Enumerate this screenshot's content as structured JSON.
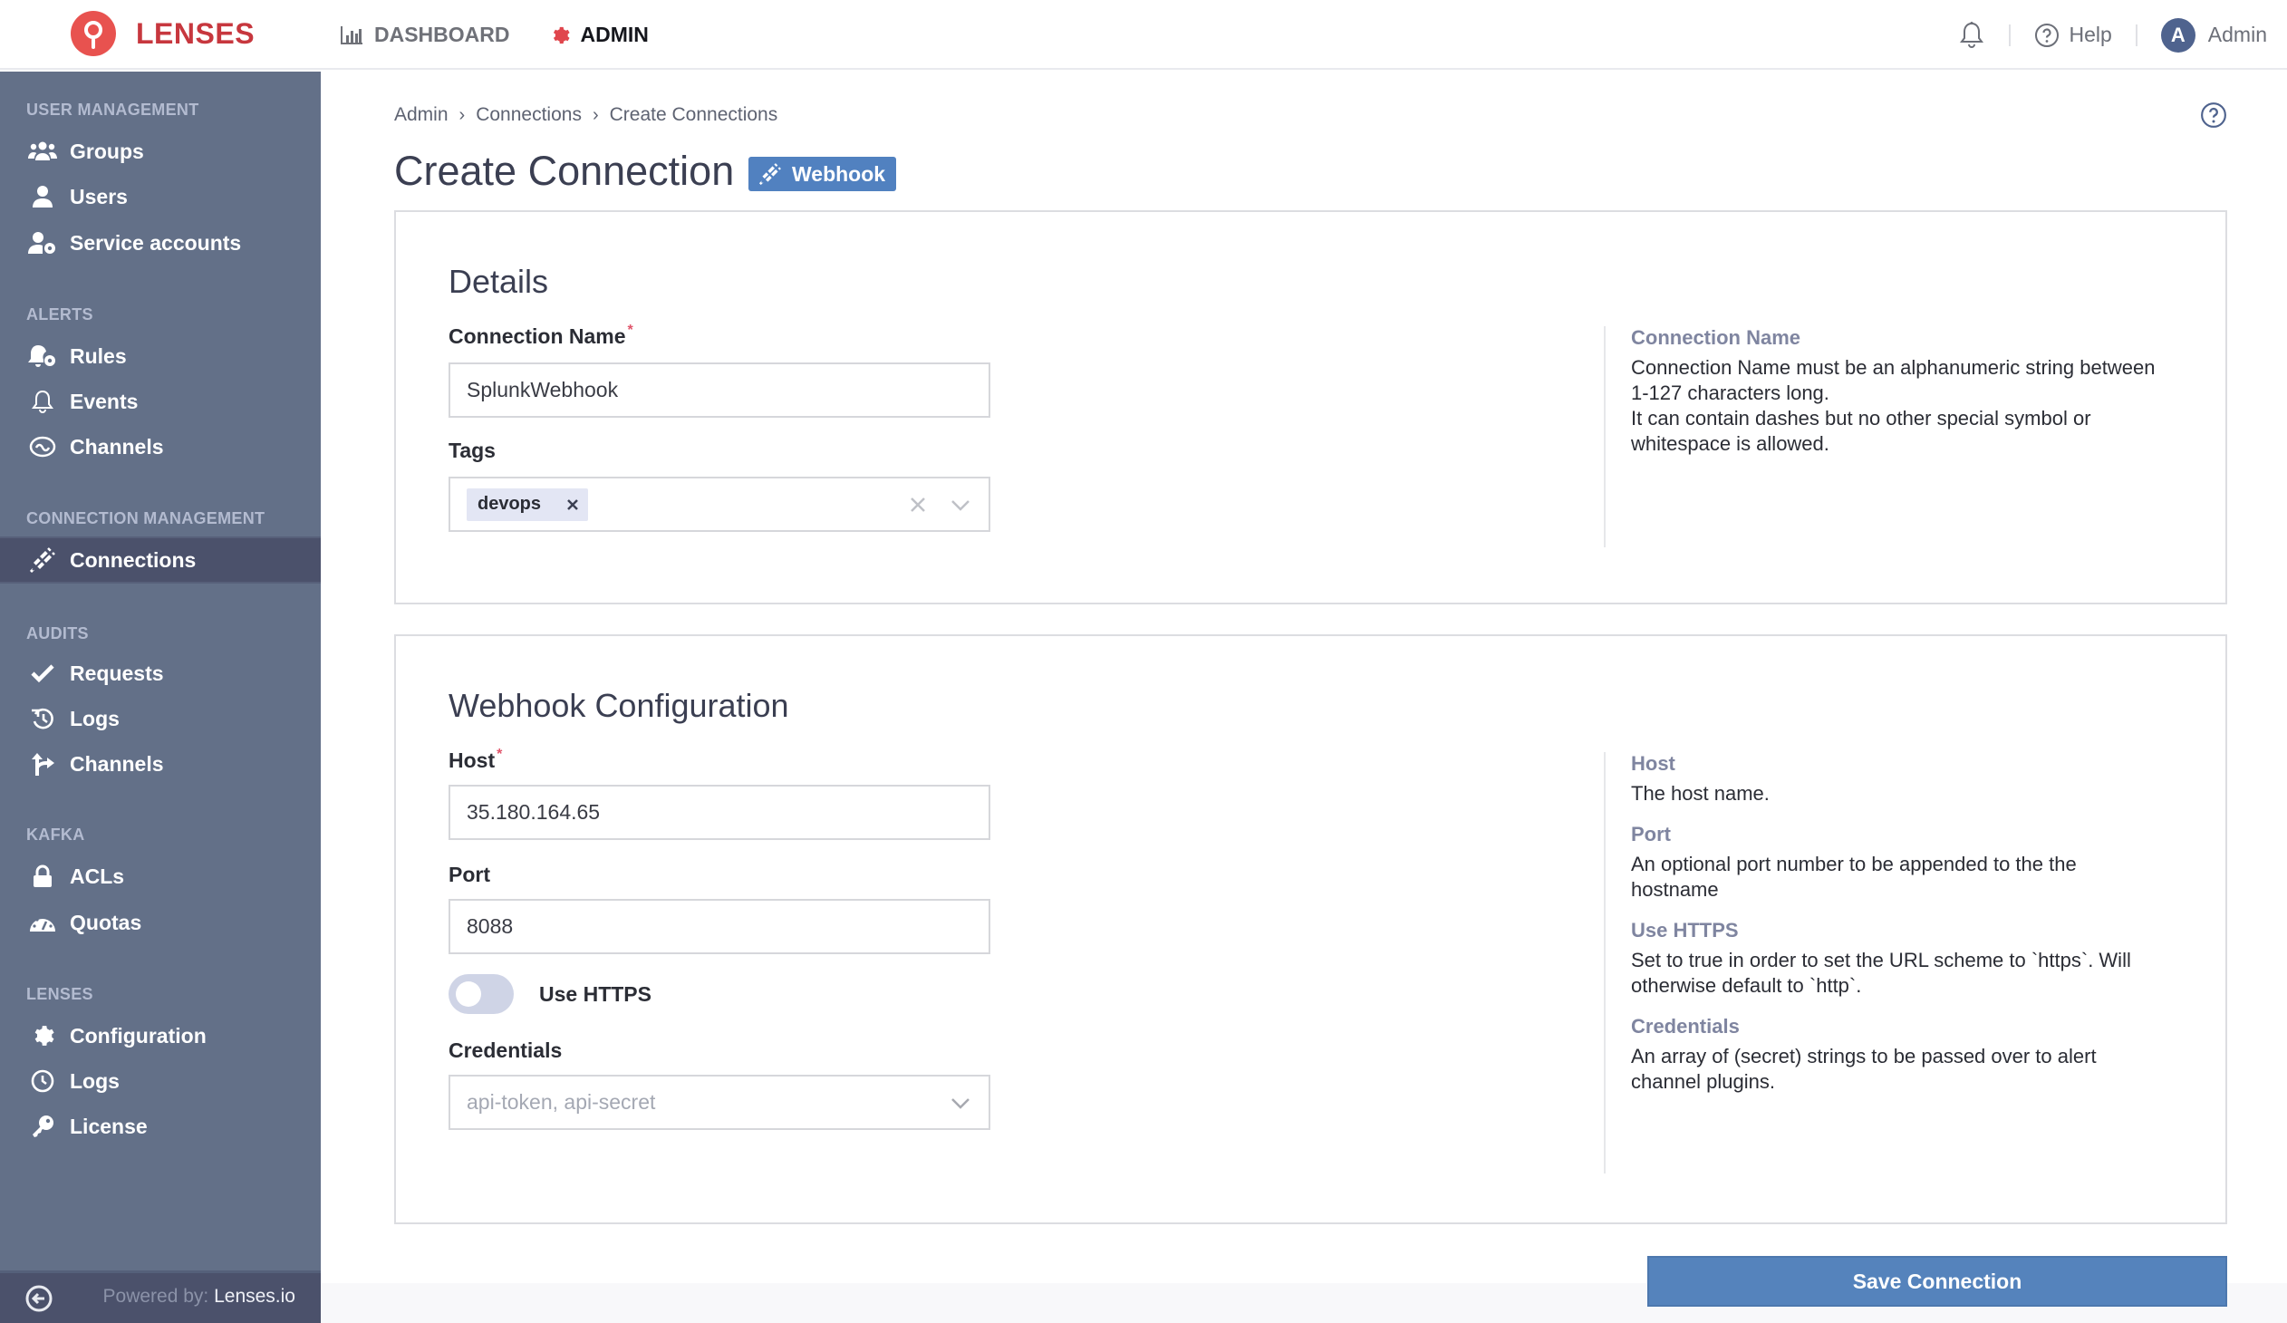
{
  "app": {
    "brand": "LENSES",
    "nav": [
      {
        "label": "DASHBOARD",
        "icon": "bar-chart-icon"
      },
      {
        "label": "ADMIN",
        "icon": "gear-icon",
        "active": true
      }
    ],
    "top_right": {
      "notifications_icon": "bell-icon",
      "help_label": "Help",
      "user_initial": "A",
      "user_name": "Admin"
    }
  },
  "sidebar": {
    "sections": [
      {
        "title": "USER MANAGEMENT",
        "items": [
          {
            "label": "Groups",
            "icon": "users-icon"
          },
          {
            "label": "Users",
            "icon": "user-icon"
          },
          {
            "label": "Service accounts",
            "icon": "user-gear-icon"
          }
        ]
      },
      {
        "title": "ALERTS",
        "items": [
          {
            "label": "Rules",
            "icon": "bell-gear-icon"
          },
          {
            "label": "Events",
            "icon": "bell-icon"
          },
          {
            "label": "Channels",
            "icon": "channels-icon"
          }
        ]
      },
      {
        "title": "CONNECTION MANAGEMENT",
        "items": [
          {
            "label": "Connections",
            "icon": "plug-icon",
            "active": true
          }
        ]
      },
      {
        "title": "AUDITS",
        "items": [
          {
            "label": "Requests",
            "icon": "check-icon"
          },
          {
            "label": "Logs",
            "icon": "history-icon"
          },
          {
            "label": "Channels",
            "icon": "split-arrow-icon"
          }
        ]
      },
      {
        "title": "KAFKA",
        "items": [
          {
            "label": "ACLs",
            "icon": "lock-icon"
          },
          {
            "label": "Quotas",
            "icon": "gauge-icon"
          }
        ]
      },
      {
        "title": "LENSES",
        "items": [
          {
            "label": "Configuration",
            "icon": "gear-icon"
          },
          {
            "label": "Logs",
            "icon": "clock-icon"
          },
          {
            "label": "License",
            "icon": "key-icon"
          }
        ]
      }
    ],
    "footer": {
      "powered_by": "Powered by:",
      "powered_name": "Lenses.io"
    }
  },
  "breadcrumb": [
    "Admin",
    "Connections",
    "Create Connections"
  ],
  "page": {
    "title": "Create Connection",
    "type_badge": "Webhook"
  },
  "details": {
    "title": "Details",
    "connection_name": {
      "label": "Connection Name",
      "required": "*",
      "value": "SplunkWebhook"
    },
    "tags": {
      "label": "Tags",
      "values": [
        "devops"
      ]
    },
    "help": [
      {
        "title": "Connection Name",
        "text": "Connection Name must be an alphanumeric string between 1-127 characters long.\nIt can contain dashes but no other special symbol or whitespace is allowed."
      }
    ]
  },
  "webhook": {
    "title": "Webhook Configuration",
    "host": {
      "label": "Host",
      "required": "*",
      "value": "35.180.164.65"
    },
    "port": {
      "label": "Port",
      "value": "8088"
    },
    "use_https": {
      "label": "Use HTTPS",
      "enabled": false
    },
    "credentials": {
      "label": "Credentials",
      "placeholder": "api-token, api-secret"
    },
    "help": [
      {
        "title": "Host",
        "text": "The host name."
      },
      {
        "title": "Port",
        "text": "An optional port number to be appended to the the hostname"
      },
      {
        "title": "Use HTTPS",
        "text": "Set to true in order to set the URL scheme to `https`. Will otherwise default to `http`."
      },
      {
        "title": "Credentials",
        "text": "An array of (secret) strings to be passed over to alert channel plugins."
      }
    ]
  },
  "actions": {
    "save_label": "Save Connection"
  },
  "colors": {
    "brand_red": "#e8524f",
    "sidebar_bg": "#637088",
    "sidebar_active": "#4b516b",
    "primary_blue": "#5583bc"
  }
}
